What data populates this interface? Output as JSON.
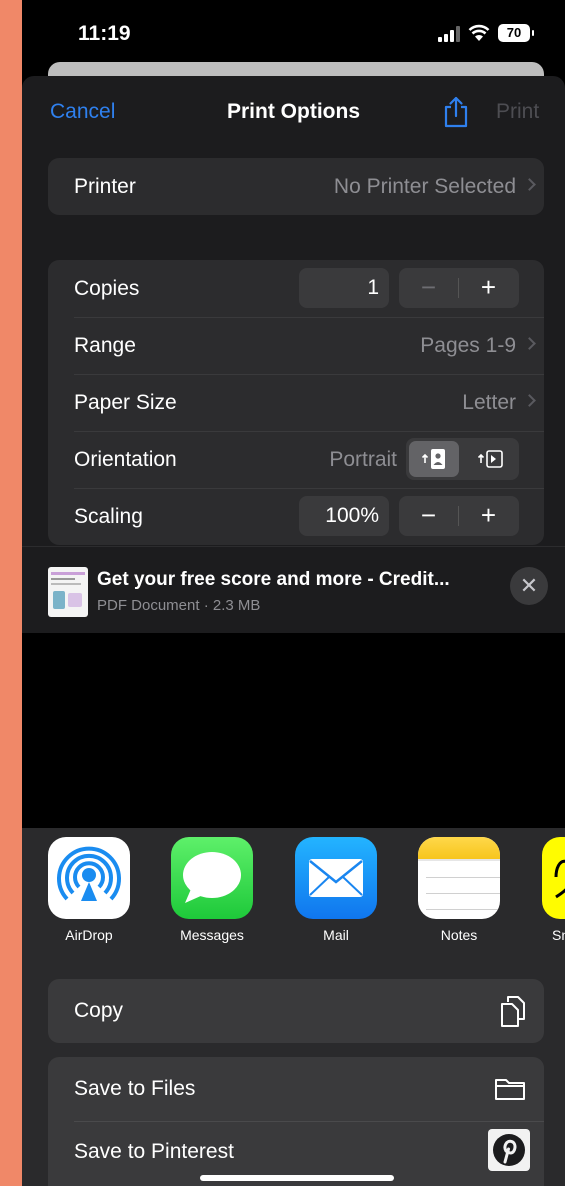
{
  "status_bar": {
    "time": "11:19",
    "battery": "70"
  },
  "nav": {
    "cancel": "Cancel",
    "title": "Print Options",
    "print": "Print"
  },
  "printer": {
    "label": "Printer",
    "value": "No Printer Selected"
  },
  "options": {
    "copies": {
      "label": "Copies",
      "value": "1",
      "minus": "−",
      "plus": "+"
    },
    "range": {
      "label": "Range",
      "value": "Pages 1-9"
    },
    "paper_size": {
      "label": "Paper Size",
      "value": "Letter"
    },
    "orientation": {
      "label": "Orientation",
      "value": "Portrait"
    },
    "scaling": {
      "label": "Scaling",
      "value": "100%",
      "minus": "−",
      "plus": "+"
    }
  },
  "document": {
    "title": "Get your free score and more - Credit...",
    "subtitle": "PDF Document · 2.3 MB"
  },
  "apps": [
    {
      "label": "AirDrop",
      "icon": "airdrop-icon"
    },
    {
      "label": "Messages",
      "icon": "messages-icon"
    },
    {
      "label": "Mail",
      "icon": "mail-icon"
    },
    {
      "label": "Notes",
      "icon": "notes-icon"
    },
    {
      "label": "Sn",
      "icon": "snapchat-icon"
    }
  ],
  "actions": {
    "copy": "Copy",
    "save_files": "Save to Files",
    "save_pinterest": "Save to Pinterest"
  },
  "colors": {
    "accent": "#2f80ee",
    "background": "#f08868"
  }
}
